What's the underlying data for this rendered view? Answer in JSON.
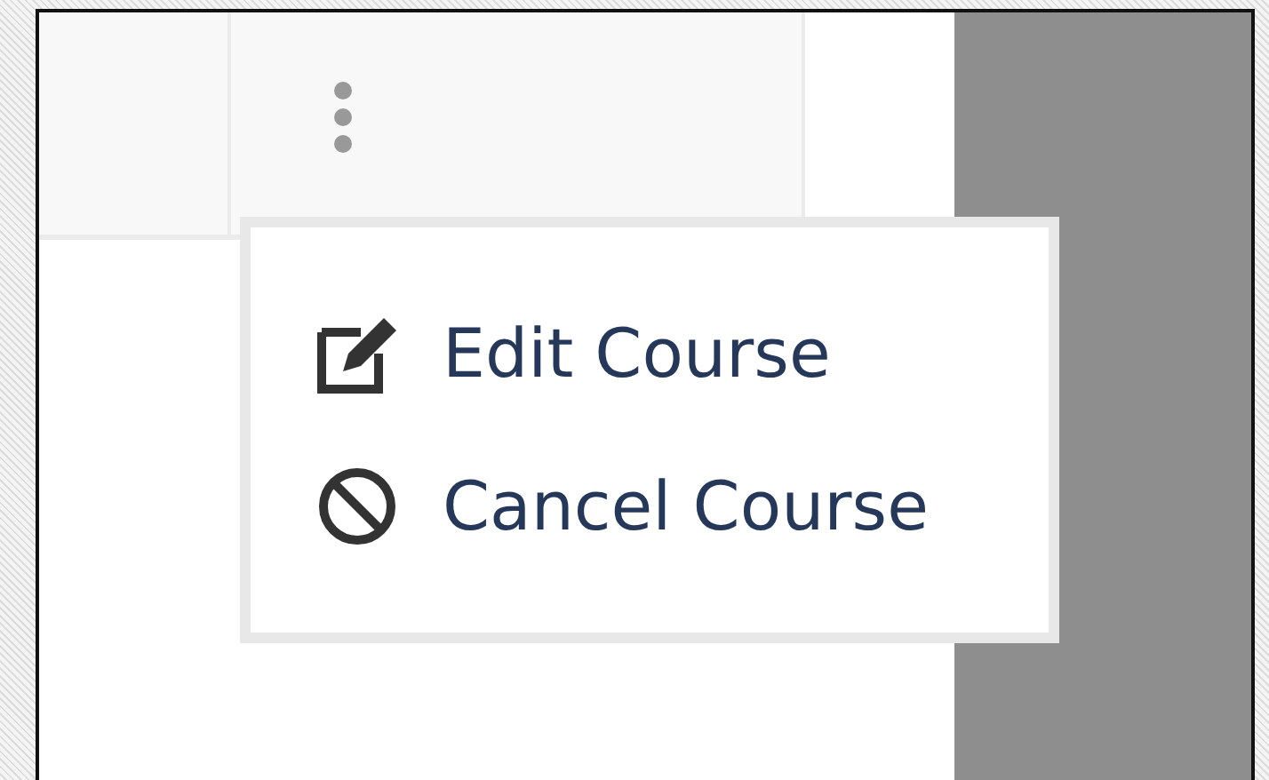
{
  "menu": {
    "items": [
      {
        "label": "Edit Course",
        "kind": "edit"
      },
      {
        "label": "Cancel Course",
        "kind": "cancel"
      }
    ]
  }
}
